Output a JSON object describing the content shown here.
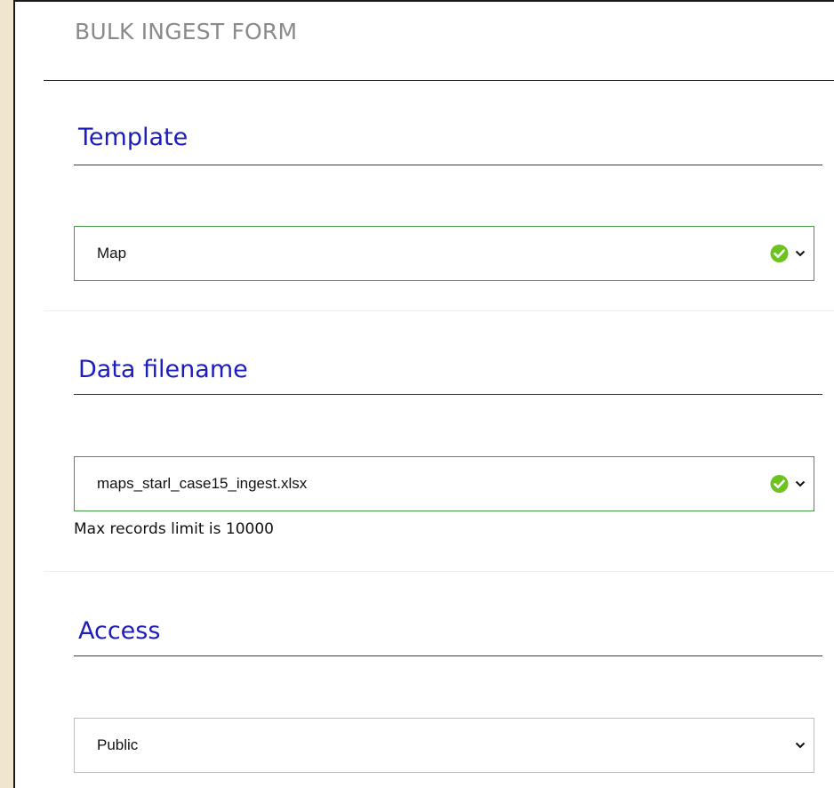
{
  "form": {
    "title": "BULK INGEST FORM"
  },
  "sections": {
    "template": {
      "heading": "Template",
      "selected": "Map"
    },
    "data_filename": {
      "heading": "Data filename",
      "selected": "maps_starl_case15_ingest.xlsx",
      "helper": "Max records limit is 10000"
    },
    "access": {
      "heading": "Access",
      "selected": "Public"
    }
  },
  "colors": {
    "heading": "#1d1dbe",
    "valid_border": "#3f9a3f",
    "check_green": "#6cc31d",
    "page_background": "#f0e6cf"
  },
  "icons": {
    "valid": "check-circle-icon",
    "dropdown": "chevron-down-icon"
  }
}
